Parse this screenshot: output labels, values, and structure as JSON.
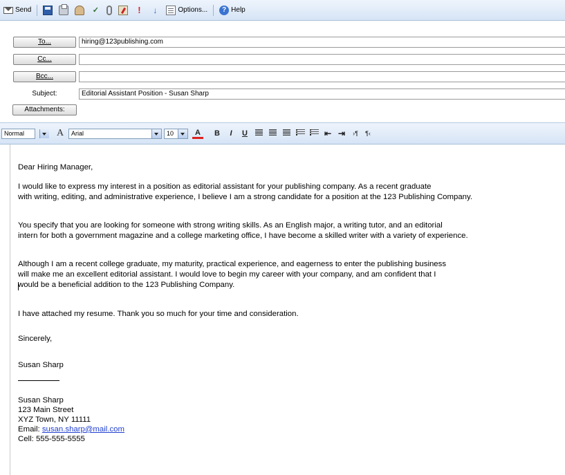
{
  "toolbar": {
    "send": "Send",
    "options": "Options...",
    "help": "Help"
  },
  "header": {
    "to_button": "To...",
    "to_value": "hiring@123publishing.com",
    "cc_button": "Cc...",
    "cc_value": "",
    "bcc_button": "Bcc...",
    "bcc_value": "",
    "subject_label": "Subject:",
    "subject_value": "Editorial Assistant Position - Susan Sharp",
    "attachments_button": "Attachments:"
  },
  "format": {
    "style": "Normal",
    "font": "Arial",
    "size": "10",
    "color_letter": "A",
    "bold": "B",
    "italic": "I",
    "underline": "U"
  },
  "body": {
    "greeting": "Dear Hiring Manager,",
    "p1_line1": "I would like to express my interest in a position as editorial assistant for your publishing company. As a recent graduate",
    "p1_line2": "with writing, editing, and administrative experience, I believe I am a strong candidate for a position at the 123 Publishing Company.",
    "p2_line1": "You specify that you are looking for someone with strong writing skills. As an English major, a writing tutor, and an editorial",
    "p2_line2": "intern for both a government magazine and a college marketing office, I have become a skilled writer with a variety of experience.",
    "p3_line1": "Although I am a recent college graduate, my maturity, practical experience, and eagerness to enter the publishing business",
    "p3_line2": "will make me an excellent editorial assistant. I would love to begin my career with your company, and am confident that I",
    "p3_line3": "would be a beneficial addition to the 123 Publishing Company.",
    "p4": "I have attached my resume. Thank you so much for your time and consideration.",
    "closing": "Sincerely,",
    "signature_name": "Susan Sharp"
  },
  "signature": {
    "name": "Susan Sharp",
    "street": "123 Main Street",
    "city": "XYZ Town, NY 11111",
    "email_label": "Email: ",
    "email": "susan.sharp@mail.com",
    "cell": "Cell: 555-555-5555"
  }
}
